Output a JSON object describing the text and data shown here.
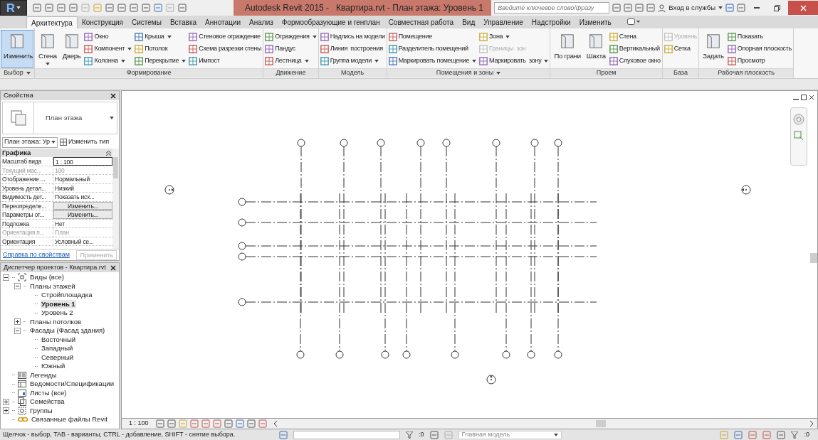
{
  "title_bar": {
    "logo": "R",
    "title": "Autodesk Revit 2015 -   Квартира.rvt - План этажа: Уровень 1",
    "search": {
      "placeholder": "Введите ключевое слово/фразу"
    },
    "sign_in": "Вход в службы"
  },
  "tabs": [
    {
      "label": "Архитектура",
      "selected": true
    },
    {
      "label": "Конструкция",
      "selected": false
    },
    {
      "label": "Системы",
      "selected": false
    },
    {
      "label": "Вставка",
      "selected": false
    },
    {
      "label": "Аннотации",
      "selected": false
    },
    {
      "label": "Анализ",
      "selected": false
    },
    {
      "label": "Формообразующие и генплан",
      "selected": false
    },
    {
      "label": "Совместная работа",
      "selected": false
    },
    {
      "label": "Вид",
      "selected": false
    },
    {
      "label": "Управление",
      "selected": false
    },
    {
      "label": "Надстройки",
      "selected": false
    },
    {
      "label": "Изменить",
      "selected": false
    }
  ],
  "ribbon": [
    {
      "label": "Выбор",
      "dropdown": true,
      "tools": [
        {
          "label": "Изменить",
          "kind": "large",
          "selected": true,
          "dropdown": false,
          "disabled": false
        }
      ]
    },
    {
      "label": "Формирование",
      "dropdown": false,
      "tools": [
        {
          "label": "Стена",
          "kind": "large",
          "selected": false,
          "dropdown": true,
          "disabled": false
        },
        {
          "label": "Дверь",
          "kind": "large",
          "selected": false,
          "dropdown": false,
          "disabled": false
        },
        {
          "label": "Окно",
          "kind": "small",
          "selected": false,
          "dropdown": false,
          "disabled": false
        },
        {
          "label": "Компонент",
          "kind": "small",
          "selected": false,
          "dropdown": true,
          "disabled": false
        },
        {
          "label": "Колонна",
          "kind": "small",
          "selected": false,
          "dropdown": true,
          "disabled": false
        },
        {
          "label": "Крыша",
          "kind": "small",
          "selected": false,
          "dropdown": true,
          "disabled": false
        },
        {
          "label": "Потолок",
          "kind": "small",
          "selected": false,
          "dropdown": false,
          "disabled": false
        },
        {
          "label": "Перекрытие",
          "kind": "small",
          "selected": false,
          "dropdown": true,
          "disabled": false
        },
        {
          "label": "Стеновое ограждение",
          "kind": "small",
          "selected": false,
          "dropdown": false,
          "disabled": false
        },
        {
          "label": "Схема разрезки стены",
          "kind": "small",
          "selected": false,
          "dropdown": false,
          "disabled": false
        },
        {
          "label": "Импост",
          "kind": "small",
          "selected": false,
          "dropdown": false,
          "disabled": false
        }
      ]
    },
    {
      "label": "Движение",
      "dropdown": false,
      "tools": [
        {
          "label": "Ограждения",
          "kind": "small",
          "selected": false,
          "dropdown": true,
          "disabled": false
        },
        {
          "label": "Пандус",
          "kind": "small",
          "selected": false,
          "dropdown": false,
          "disabled": false
        },
        {
          "label": "Лестница",
          "kind": "small",
          "selected": false,
          "dropdown": true,
          "disabled": false
        }
      ]
    },
    {
      "label": "Модель",
      "dropdown": false,
      "tools": [
        {
          "label": "Надпись на модели",
          "kind": "small",
          "selected": false,
          "dropdown": false,
          "disabled": false
        },
        {
          "label": "Линия  построения",
          "kind": "small",
          "selected": false,
          "dropdown": false,
          "disabled": false
        },
        {
          "label": "Группа модели",
          "kind": "small",
          "selected": false,
          "dropdown": true,
          "disabled": false
        }
      ]
    },
    {
      "label": "Помещения и зоны",
      "dropdown": true,
      "tools": [
        {
          "label": "Помещение",
          "kind": "small",
          "selected": false,
          "dropdown": false,
          "disabled": false
        },
        {
          "label": "Разделитель помещений",
          "kind": "small",
          "selected": false,
          "dropdown": false,
          "disabled": false
        },
        {
          "label": "Маркировать помещение",
          "kind": "small",
          "selected": false,
          "dropdown": true,
          "disabled": false
        },
        {
          "label": "Зона",
          "kind": "small",
          "selected": false,
          "dropdown": true,
          "disabled": false
        },
        {
          "label": "Границы  зон",
          "kind": "small",
          "selected": false,
          "dropdown": false,
          "disabled": true
        },
        {
          "label": "Маркировать  зону",
          "kind": "small",
          "selected": false,
          "dropdown": true,
          "disabled": false
        }
      ]
    },
    {
      "label": "Проем",
      "dropdown": false,
      "tools": [
        {
          "label": "По грани",
          "kind": "large",
          "selected": false,
          "dropdown": false,
          "disabled": false
        },
        {
          "label": "Шахта",
          "kind": "large",
          "selected": false,
          "dropdown": false,
          "disabled": false
        },
        {
          "label": "Стена",
          "kind": "small",
          "selected": false,
          "dropdown": false,
          "disabled": false
        },
        {
          "label": "Вертикальный",
          "kind": "small",
          "selected": false,
          "dropdown": false,
          "disabled": false
        },
        {
          "label": "Слуховое окно",
          "kind": "small",
          "selected": false,
          "dropdown": false,
          "disabled": false
        }
      ]
    },
    {
      "label": "База",
      "dropdown": false,
      "tools": [
        {
          "label": "Уровень",
          "kind": "small",
          "selected": false,
          "dropdown": false,
          "disabled": true
        },
        {
          "label": "Сетка",
          "kind": "small",
          "selected": false,
          "dropdown": false,
          "disabled": false
        }
      ]
    },
    {
      "label": "Рабочая плоскость",
      "dropdown": false,
      "tools": [
        {
          "label": "Задать",
          "kind": "large",
          "selected": false,
          "dropdown": false,
          "disabled": false
        },
        {
          "label": "Показать",
          "kind": "small",
          "selected": false,
          "dropdown": false,
          "disabled": false
        },
        {
          "label": "Опорная плоскость",
          "kind": "small",
          "selected": false,
          "dropdown": false,
          "disabled": false
        },
        {
          "label": "Просмотр",
          "kind": "small",
          "selected": false,
          "dropdown": false,
          "disabled": false
        }
      ]
    }
  ],
  "properties": {
    "title": "Свойства",
    "type_name": "План этажа",
    "instance_selector": "План этажа: Ур",
    "edit_type": "Изменить тип",
    "group": "Графика",
    "rows": [
      {
        "name": "Масштаб вида",
        "value": "1 : 100",
        "kind": "field",
        "disabled": false
      },
      {
        "name": "Текущий мас...",
        "value": "100",
        "kind": "text",
        "disabled": true
      },
      {
        "name": "Отображение ...",
        "value": "Нормальный",
        "kind": "text",
        "disabled": false
      },
      {
        "name": "Уровень детал...",
        "value": "Низкий",
        "kind": "text",
        "disabled": false
      },
      {
        "name": "Видимость дет...",
        "value": "Показать исх...",
        "kind": "text",
        "disabled": false
      },
      {
        "name": "Переопределе...",
        "value": "Изменить...",
        "kind": "button",
        "disabled": false
      },
      {
        "name": "Параметры от...",
        "value": "Изменить...",
        "kind": "button",
        "disabled": false
      },
      {
        "name": "Подложка",
        "value": "Нет",
        "kind": "text",
        "disabled": false
      },
      {
        "name": "Ориентация п...",
        "value": "План",
        "kind": "text",
        "disabled": true
      },
      {
        "name": "Ориентация",
        "value": "Условный се...",
        "kind": "text",
        "disabled": false
      }
    ],
    "help_link": "Справка по свойствам",
    "apply": {
      "label": "Применить",
      "disabled": true
    }
  },
  "project_browser": {
    "title": "Диспетчер проектов - Квартира.rvt",
    "tree": [
      {
        "label": "Виды (все)",
        "kind": "views",
        "expanded": true,
        "selected": false,
        "children": [
          {
            "label": "Планы этажей",
            "expanded": true,
            "selected": false,
            "children": [
              {
                "label": "Стройплощадка",
                "selected": false
              },
              {
                "label": "Уровень 1",
                "selected": true
              },
              {
                "label": "Уровень 2",
                "selected": false
              }
            ]
          },
          {
            "label": "Планы потолков",
            "expanded": false,
            "selected": false
          },
          {
            "label": "Фасады (Фасад здания)",
            "expanded": true,
            "selected": false,
            "children": [
              {
                "label": "Восточный",
                "selected": false
              },
              {
                "label": "Западный",
                "selected": false
              },
              {
                "label": "Северный",
                "selected": false
              },
              {
                "label": "Южный",
                "selected": false
              }
            ]
          }
        ]
      },
      {
        "label": "Легенды",
        "kind": "legend",
        "selected": false
      },
      {
        "label": "Ведомости/Спецификации",
        "kind": "schedule",
        "selected": false
      },
      {
        "label": "Листы (все)",
        "kind": "sheet",
        "selected": false
      },
      {
        "label": "Семейства",
        "kind": "family",
        "expanded": false,
        "selected": false
      },
      {
        "label": "Группы",
        "kind": "group",
        "expanded": false,
        "selected": false
      },
      {
        "label": "Связанные файлы Revit",
        "kind": "link",
        "selected": false
      }
    ]
  },
  "view_bar": {
    "scale": "1 : 100"
  },
  "status_bar": {
    "message": "Щелчок - выбор, TAB - варианты, CTRL - добавление, SHIFT - снятие выбора.",
    "count": ":0",
    "workset": "Главная модель",
    "filter_count": ":0"
  }
}
